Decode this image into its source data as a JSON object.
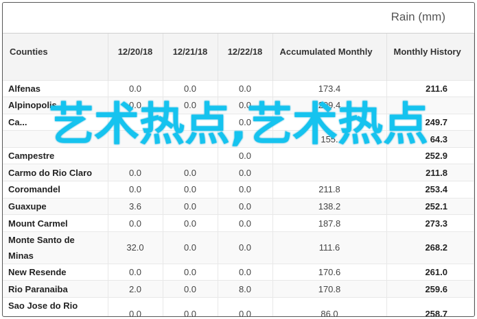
{
  "caption": "Rain (mm)",
  "headers": {
    "counties": "Counties",
    "d1": "12/20/18",
    "d2": "12/21/18",
    "d3": "12/22/18",
    "accumulated": "Accumulated Monthly",
    "history": "Monthly History"
  },
  "rows": [
    {
      "county": "Alfenas",
      "d1": "0.0",
      "d2": "0.0",
      "d3": "0.0",
      "acc": "173.4",
      "hist": "211.6"
    },
    {
      "county": "Alpinopolis",
      "d1": "0.0",
      "d2": "0.0",
      "d3": "0.0",
      "acc": "209.4",
      "hist": ""
    },
    {
      "county": "Ca...",
      "d1": "",
      "d2": "",
      "d3": "0.0",
      "acc": "",
      "hist": "249.7"
    },
    {
      "county": "",
      "d1": "",
      "d2": "",
      "d3": "",
      "acc": "155.",
      "hist": "64.3"
    },
    {
      "county": "Campestre",
      "d1": "",
      "d2": "",
      "d3": "0.0",
      "acc": "",
      "hist": "252.9"
    },
    {
      "county": "Carmo do Rio Claro",
      "d1": "0.0",
      "d2": "0.0",
      "d3": "0.0",
      "acc": "",
      "hist": "211.8"
    },
    {
      "county": "Coromandel",
      "d1": "0.0",
      "d2": "0.0",
      "d3": "0.0",
      "acc": "211.8",
      "hist": "253.4"
    },
    {
      "county": "Guaxupe",
      "d1": "3.6",
      "d2": "0.0",
      "d3": "0.0",
      "acc": "138.2",
      "hist": "252.1"
    },
    {
      "county": "Mount Carmel",
      "d1": "0.0",
      "d2": "0.0",
      "d3": "0.0",
      "acc": "187.8",
      "hist": "273.3"
    },
    {
      "county": "Monte Santo de Minas",
      "d1": "32.0",
      "d2": "0.0",
      "d3": "0.0",
      "acc": "111.6",
      "hist": "268.2"
    },
    {
      "county": "New Resende",
      "d1": "0.0",
      "d2": "0.0",
      "d3": "0.0",
      "acc": "170.6",
      "hist": "261.0"
    },
    {
      "county": "Rio Paranaiba",
      "d1": "2.0",
      "d2": "0.0",
      "d3": "8.0",
      "acc": "170.8",
      "hist": "259.6"
    },
    {
      "county": "Sao Jose do Rio Pardo",
      "d1": "0.0",
      "d2": "0.0",
      "d3": "0.0",
      "acc": "86.0",
      "hist": "258.7"
    }
  ],
  "overlay": "艺术热点,艺术热点"
}
